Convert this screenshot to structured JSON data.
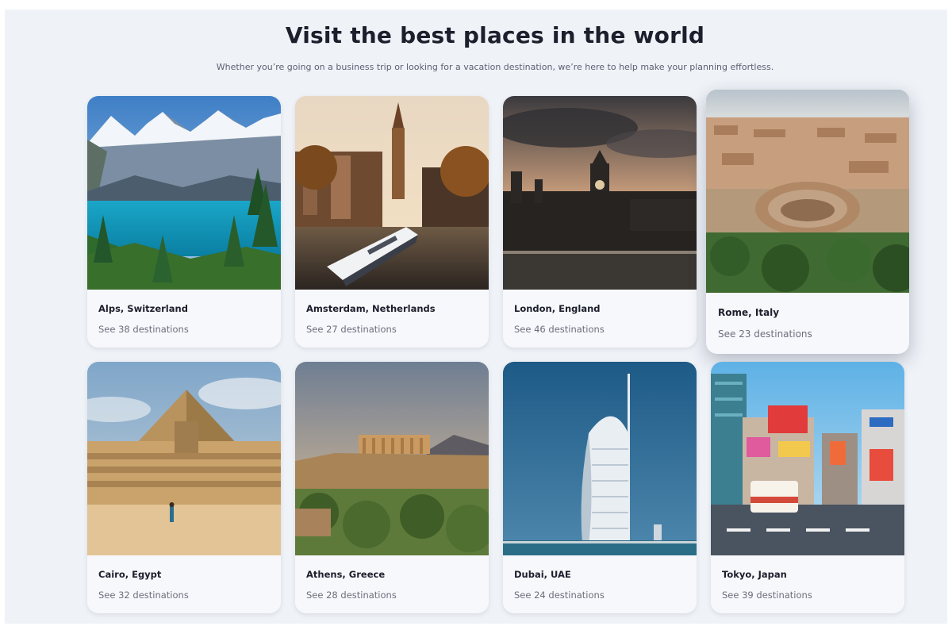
{
  "header": {
    "title": "Visit the best places in the world",
    "subtitle": "Whether you’re going on a business trip or looking for a vacation destination, we’re here to help make your planning effortless."
  },
  "destinations": [
    {
      "name": "Alps, Switzerland",
      "count": "See 38 destinations"
    },
    {
      "name": "Amsterdam, Netherlands",
      "count": "See 27 destinations"
    },
    {
      "name": "London, England",
      "count": "See 46 destinations"
    },
    {
      "name": "Rome, Italy",
      "count": "See 23 destinations"
    },
    {
      "name": "Cairo, Egypt",
      "count": "See 32 destinations"
    },
    {
      "name": "Athens, Greece",
      "count": "See 28 destinations"
    },
    {
      "name": "Dubai, UAE",
      "count": "See 24 destinations"
    },
    {
      "name": "Tokyo, Japan",
      "count": "See 39 destinations"
    }
  ]
}
